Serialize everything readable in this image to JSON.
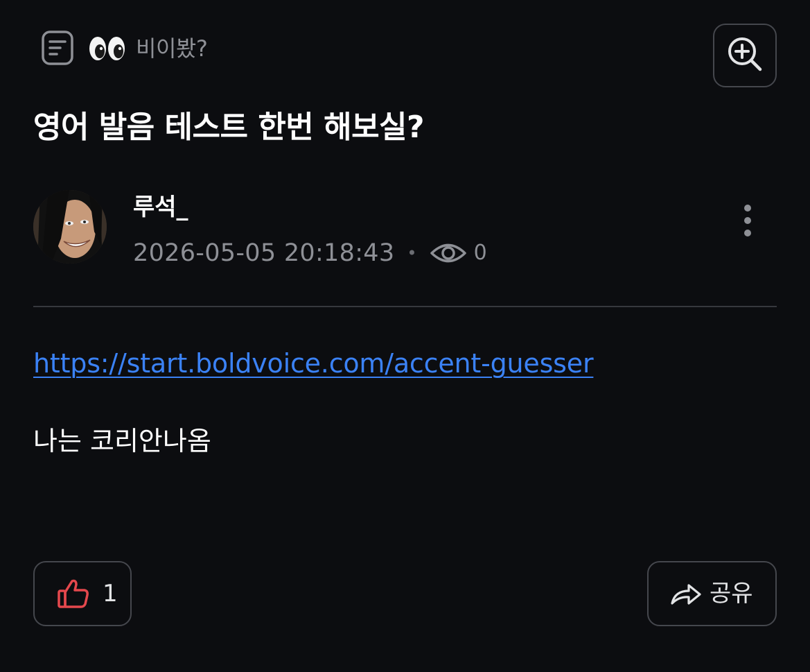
{
  "header": {
    "category_emoji": "eyes-emoji",
    "category_label": "비이봤?",
    "board_icon": "list-document-icon",
    "zoom_icon": "zoom-in-icon"
  },
  "post": {
    "title": "영어 발음 테스트 한번 해보실?",
    "author": {
      "name": "루석_",
      "avatar": "avatar-image"
    },
    "date": "2026-05-05 20:18:43",
    "separator": "•",
    "views_icon": "eye-icon",
    "views": "0",
    "link": "https://start.boldvoice.com/accent-guesser",
    "body": "나는 코리안나옴"
  },
  "actions": {
    "like_icon": "thumbs-up-icon",
    "like_count": "1",
    "share_icon": "share-arrow-icon",
    "share_label": "공유",
    "more_icon": "more-vertical-icon"
  },
  "colors": {
    "background": "#0c0d10",
    "link": "#3b82f6",
    "muted": "#8e9096",
    "like": "#e5484d",
    "border": "#45474d"
  }
}
